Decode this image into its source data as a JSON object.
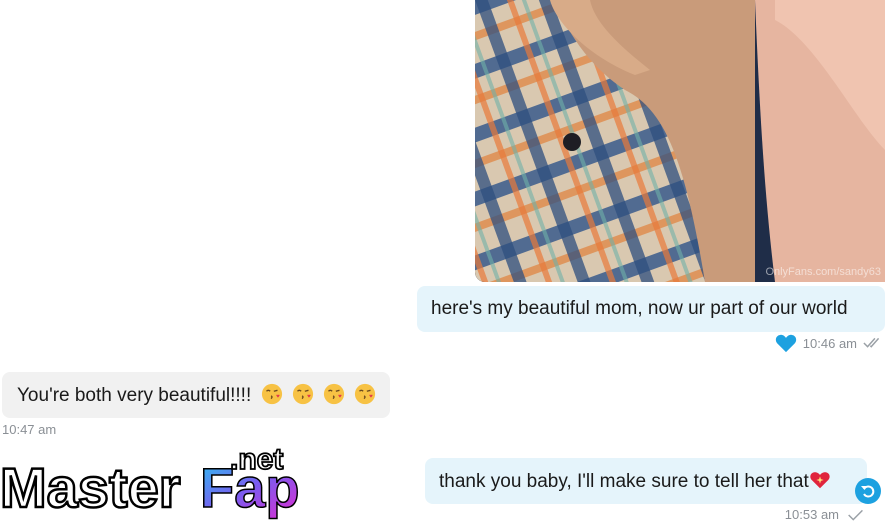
{
  "colors": {
    "outgoing_bubble": "#e5f4fb",
    "incoming_bubble": "#f1f1f1",
    "accent": "#1da1e0",
    "meta_text": "#8a8f95"
  },
  "media": {
    "watermark": "OnlyFans.com/sandy63"
  },
  "messages": [
    {
      "direction": "outgoing",
      "text": "here's my beautiful mom, now ur part of our world",
      "time": "10:46 am",
      "liked": true,
      "status": "read"
    },
    {
      "direction": "incoming",
      "text": "You're both very beautiful!!!!",
      "emojis": [
        "kissing-face-icon",
        "kissing-face-icon",
        "kissing-face-icon",
        "kissing-face-icon"
      ],
      "time": "10:47 am"
    },
    {
      "direction": "outgoing",
      "text": "thank you baby, I'll make sure to tell her that",
      "emojis": [
        "sparkling-heart-icon"
      ],
      "time": "10:53 am",
      "status": "sent"
    }
  ],
  "overlay_logo": {
    "text_part_1": "Master",
    "text_part_2": "Fap",
    "text_part_3": ".net"
  }
}
